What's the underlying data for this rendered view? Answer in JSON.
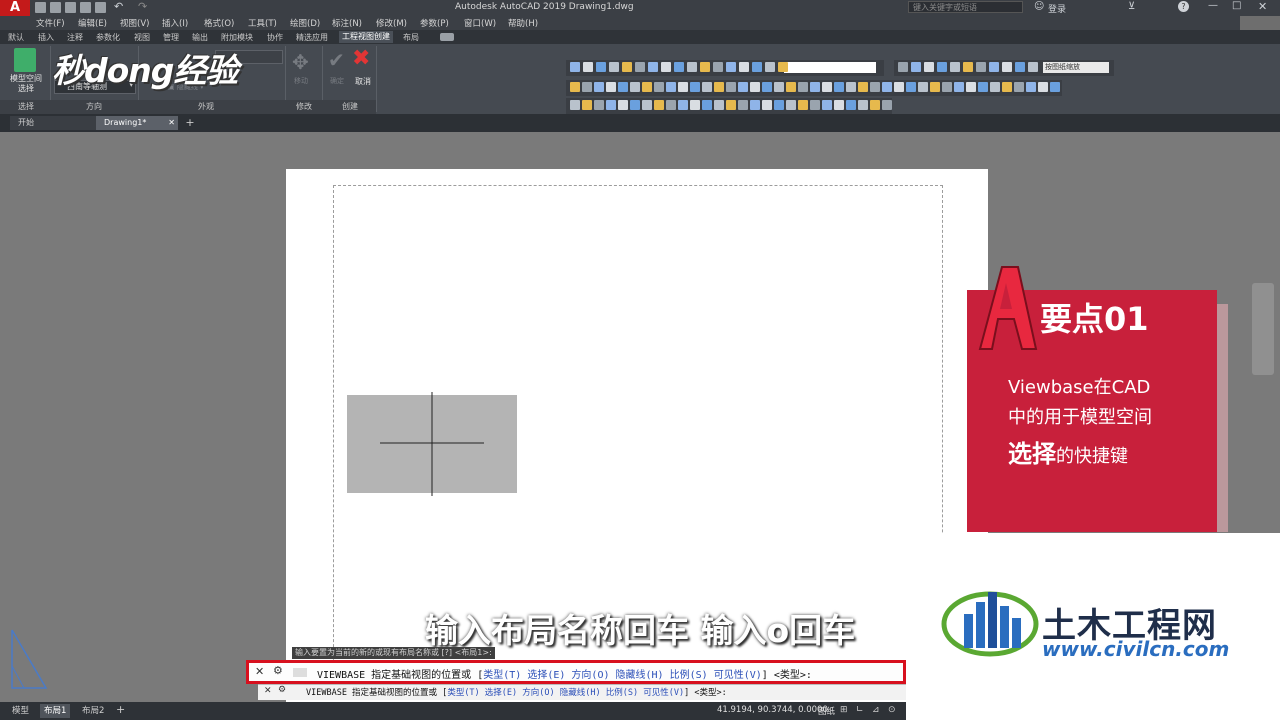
{
  "title_bar": {
    "app_title": "Autodesk AutoCAD 2019    Drawing1.dwg",
    "search_placeholder": "键入关键字或短语",
    "login_label": "登录"
  },
  "menu_bar": {
    "items": [
      "文件(F)",
      "编辑(E)",
      "视图(V)",
      "插入(I)",
      "格式(O)",
      "工具(T)",
      "绘图(D)",
      "标注(N)",
      "修改(M)",
      "参数(P)",
      "窗口(W)",
      "帮助(H)"
    ]
  },
  "ribbon_tabs": {
    "items": [
      "默认",
      "插入",
      "注释",
      "参数化",
      "视图",
      "管理",
      "输出",
      "附加模块",
      "协作",
      "精选应用",
      "工程视图创建",
      "布局"
    ],
    "active_index": 10
  },
  "ribbon": {
    "model_space_label": "模型空间\n选择",
    "view_direction_value": "西南等轴测",
    "move_label": "移动",
    "confirm_label": "确定",
    "cancel_label": "取消",
    "panel_select": "选择",
    "panel_direction": "方向",
    "panel_appearance": "外观",
    "panel_modify": "修改",
    "panel_create": "创建",
    "scale_dropdown": "按图纸缩放"
  },
  "doc_tabs": {
    "start": "开始",
    "drawing": "Drawing1*"
  },
  "logo_watermark": "秒dong经验",
  "card": {
    "heading": "要点01",
    "line1": "Viewbase在CAD",
    "line2": "中的用于模型空间",
    "line3_emphasis": "选择",
    "line3_rest": "的快捷键"
  },
  "civil_logo": {
    "name": "土木工程网",
    "url": "www.civilcn.com"
  },
  "subtitle": "输入布局名称回车 输入o回车",
  "command": {
    "hint": "输入要置为当前的新的或现有布局名称或 [?] <布局1>:",
    "main_cmd": "VIEWBASE 指定基础视图的位置或",
    "options": [
      "类型(T)",
      "选择(E)",
      "方向(O)",
      "隐藏线(H)",
      "比例(S)",
      "可见性(V)"
    ],
    "suffix": "<类型>:",
    "small_cmd": "VIEWBASE 指定基础视图的位置或",
    "small_suffix": "<类型>:"
  },
  "status_bar": {
    "tabs": [
      "模型",
      "布局1",
      "布局2"
    ],
    "active_index": 1,
    "coords": "41.9194, 90.3744, 0.0000",
    "paper_label": "图纸"
  },
  "colors": {
    "card_red": "#c8203b",
    "highlight_red": "#d7101e",
    "option_blue": "#2b4fb8"
  }
}
